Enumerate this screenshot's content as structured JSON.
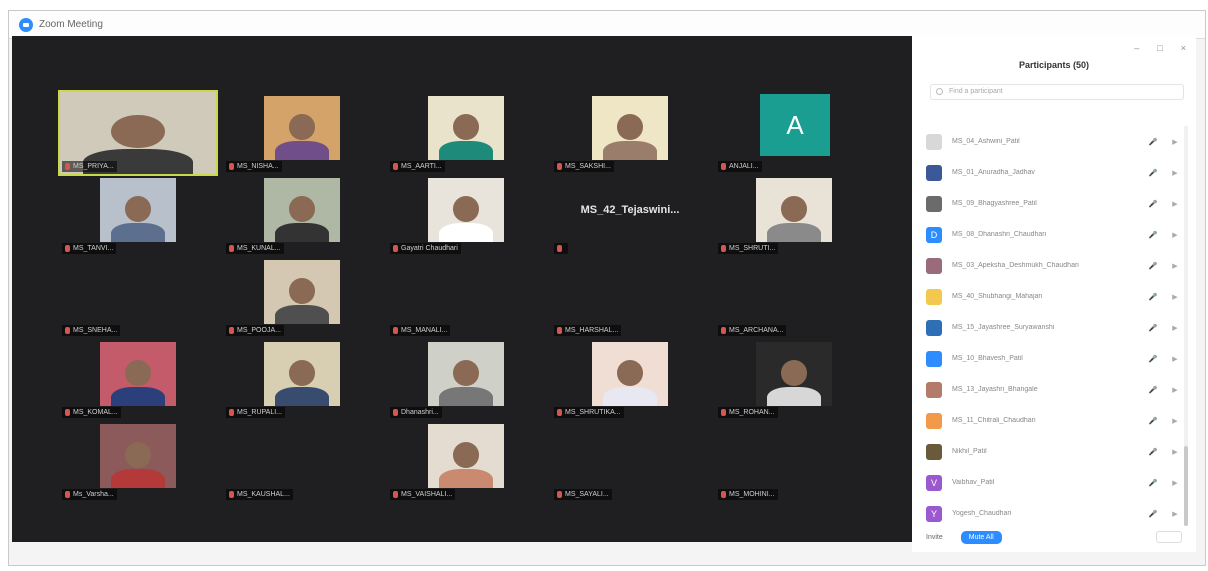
{
  "window": {
    "title": "Zoom Meeting"
  },
  "video_grid": {
    "tiles": [
      {
        "name": "MS_PRIYA...",
        "speaking": true,
        "has_video": true,
        "wall": "#cfcab9",
        "shirt": "#3a3a3a"
      },
      {
        "name": "MS_NISHA...",
        "speaking": false,
        "has_video": true,
        "wall": "#d3a36a",
        "shirt": "#6f4e8a"
      },
      {
        "name": "MS_AARTI...",
        "speaking": false,
        "has_video": true,
        "wall": "#e9e3cc",
        "shirt": "#1d8a7a"
      },
      {
        "name": "MS_SAKSHI...",
        "speaking": false,
        "has_video": true,
        "wall": "#efe6c5",
        "shirt": "#9a7d6a"
      },
      {
        "name": "ANJALI...",
        "speaking": false,
        "has_video": false,
        "initial": "A"
      },
      {
        "name": "MS_TANVI...",
        "speaking": false,
        "has_video": true,
        "wall": "#b8c0cc",
        "shirt": "#5c6f8f"
      },
      {
        "name": "MS_KUNAL...",
        "speaking": false,
        "has_video": true,
        "wall": "#aeb8a4",
        "shirt": "#333333"
      },
      {
        "name": "Gayatri Chaudhari",
        "speaking": false,
        "has_video": true,
        "wall": "#e8e4dc",
        "shirt": "#ffffff"
      },
      {
        "name": "MS_42_Tejaswini...",
        "speaking": false,
        "has_video": false
      },
      {
        "name": "MS_SHRUTI...",
        "speaking": false,
        "has_video": true,
        "wall": "#e9e2d6",
        "shirt": "#8a8a8a"
      },
      {
        "name": "MS_SNEHA...",
        "speaking": false,
        "has_video": false
      },
      {
        "name": "MS_POOJA...",
        "speaking": false,
        "has_video": true,
        "wall": "#d4c8b2",
        "shirt": "#4f4f4f"
      },
      {
        "name": "MS_MANALI...",
        "speaking": false,
        "has_video": false
      },
      {
        "name": "MS_HARSHAL...",
        "speaking": false,
        "has_video": false
      },
      {
        "name": "MS_ARCHANA...",
        "speaking": false,
        "has_video": false
      },
      {
        "name": "MS_KOMAL...",
        "speaking": false,
        "has_video": true,
        "wall": "#c45b6a",
        "shirt": "#2b3f7a"
      },
      {
        "name": "MS_RUPALI...",
        "speaking": false,
        "has_video": true,
        "wall": "#d8cfb2",
        "shirt": "#374c6e"
      },
      {
        "name": "Dhanashri...",
        "speaking": false,
        "has_video": true,
        "wall": "#cfd1c8",
        "shirt": "#777777"
      },
      {
        "name": "MS_SHRUTIKA...",
        "speaking": false,
        "has_video": true,
        "wall": "#f0ddd4",
        "shirt": "#e8e8f2"
      },
      {
        "name": "MS_ROHAN...",
        "speaking": false,
        "has_video": true,
        "wall": "#2a2a2a",
        "shirt": "#d7d7d7"
      },
      {
        "name": "Ms_Varsha...",
        "speaking": false,
        "has_video": true,
        "wall": "#8c5a5a",
        "shirt": "#b43a3a"
      },
      {
        "name": "MS_KAUSHAL...",
        "speaking": false,
        "has_video": false
      },
      {
        "name": "MS_VAISHALI...",
        "speaking": false,
        "has_video": true,
        "wall": "#e4dcd0",
        "shirt": "#c98a70"
      },
      {
        "name": "MS_SAYALI...",
        "speaking": false,
        "has_video": false
      },
      {
        "name": "MS_MOHINI...",
        "speaking": false,
        "has_video": false
      }
    ]
  },
  "participants_panel": {
    "title": "Participants (50)",
    "search_placeholder": "Find a participant",
    "participants": [
      {
        "name": "MS_04_Ashwini_Patil",
        "avatar_color": "#d8d8d8",
        "avatar_text": ""
      },
      {
        "name": "MS_01_Anuradha_Jadhav",
        "avatar_color": "#3b5998",
        "avatar_text": ""
      },
      {
        "name": "MS_09_Bhagyashree_Patil",
        "avatar_color": "#6b6b6b",
        "avatar_text": ""
      },
      {
        "name": "MS_08_Dhanashri_Chaudhari",
        "avatar_color": "#2d8cff",
        "avatar_text": "D"
      },
      {
        "name": "MS_03_Apeksha_Deshmukh_Chaudhari",
        "avatar_color": "#9a6b7a",
        "avatar_text": ""
      },
      {
        "name": "MS_40_Shubhangi_Mahajan",
        "avatar_color": "#f2c94c",
        "avatar_text": ""
      },
      {
        "name": "MS_15_Jayashree_Suryawanshi",
        "avatar_color": "#2f6fb5",
        "avatar_text": ""
      },
      {
        "name": "MS_10_Bhavesh_Patil",
        "avatar_color": "#2d8cff",
        "avatar_text": ""
      },
      {
        "name": "MS_13_Jayashri_Bhangale",
        "avatar_color": "#b47a6a",
        "avatar_text": ""
      },
      {
        "name": "MS_11_Chitrali_Chaudhari",
        "avatar_color": "#f2994a",
        "avatar_text": ""
      },
      {
        "name": "Nikhil_Patil",
        "avatar_color": "#6b5a3a",
        "avatar_text": ""
      },
      {
        "name": "Vaibhav_Patil",
        "avatar_color": "#9b59d0",
        "avatar_text": "V"
      },
      {
        "name": "Yogesh_Chaudhari",
        "avatar_color": "#9b59d0",
        "avatar_text": "Y"
      }
    ],
    "footer": {
      "invite_label": "Invite",
      "mute_all_label": "Mute All"
    }
  }
}
